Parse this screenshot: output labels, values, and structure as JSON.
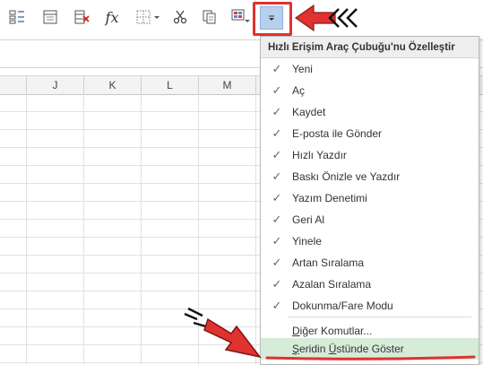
{
  "menu": {
    "title": "Hızlı Erişim Araç Çubuğu'nu Özelleştir",
    "items": [
      {
        "label": "Yeni",
        "checked": true
      },
      {
        "label": "Aç",
        "checked": true
      },
      {
        "label": "Kaydet",
        "checked": true
      },
      {
        "label": "E-posta ile Gönder",
        "checked": true
      },
      {
        "label": "Hızlı Yazdır",
        "checked": true
      },
      {
        "label": "Baskı Önizle ve Yazdır",
        "checked": true
      },
      {
        "label": "Yazım Denetimi",
        "checked": true
      },
      {
        "label": "Geri Al",
        "checked": true
      },
      {
        "label": "Yinele",
        "checked": true
      },
      {
        "label": "Artan Sıralama",
        "checked": true
      },
      {
        "label": "Azalan Sıralama",
        "checked": true
      },
      {
        "label": "Dokunma/Fare Modu",
        "checked": true
      }
    ],
    "more_commands": {
      "prefix": "",
      "underlined": "D",
      "rest": "iğer Komutlar..."
    },
    "show_above": {
      "underlined1": "Ş",
      "mid": "eridin ",
      "underlined2": "Ü",
      "rest": "stünde Göster"
    }
  },
  "columns": [
    "J",
    "K",
    "L",
    "M"
  ],
  "toolbar": {
    "fx_label": "fx",
    "icons": [
      "form-icon",
      "table-properties-icon",
      "delete-table-icon",
      "function-icon",
      "borders-icon",
      "cut-icon",
      "copy-icon",
      "format-painter-icon",
      "customize-qat-icon"
    ]
  },
  "colors": {
    "highlight": "#e0322f",
    "selected_button": "#b8d0ee",
    "hover_row": "#d6ecd9"
  }
}
